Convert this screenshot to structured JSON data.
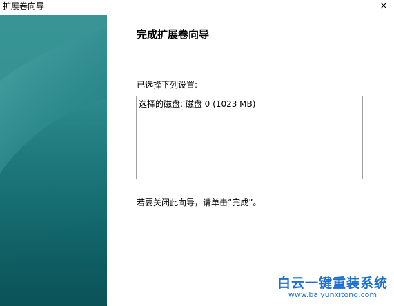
{
  "window": {
    "title": "扩展卷向导",
    "close_glyph": "✕"
  },
  "content": {
    "heading": "完成扩展卷向导",
    "settings_label": "已选择下列设置:",
    "settings_lines": [
      "选择的磁盘: 磁盘 0 (1023 MB)"
    ],
    "finish_hint": "若要关闭此向导，请单击“完成”。"
  },
  "watermark": {
    "brand": "白云一键重装系统",
    "url": "www.baiyunxitong.com"
  },
  "colors": {
    "side_panel_top": "#2e8a8c",
    "side_panel_bottom": "#0b5257",
    "watermark": "#1c6fd1",
    "box_border": "#a0a0a0"
  },
  "icons": {
    "close": "close-icon"
  }
}
